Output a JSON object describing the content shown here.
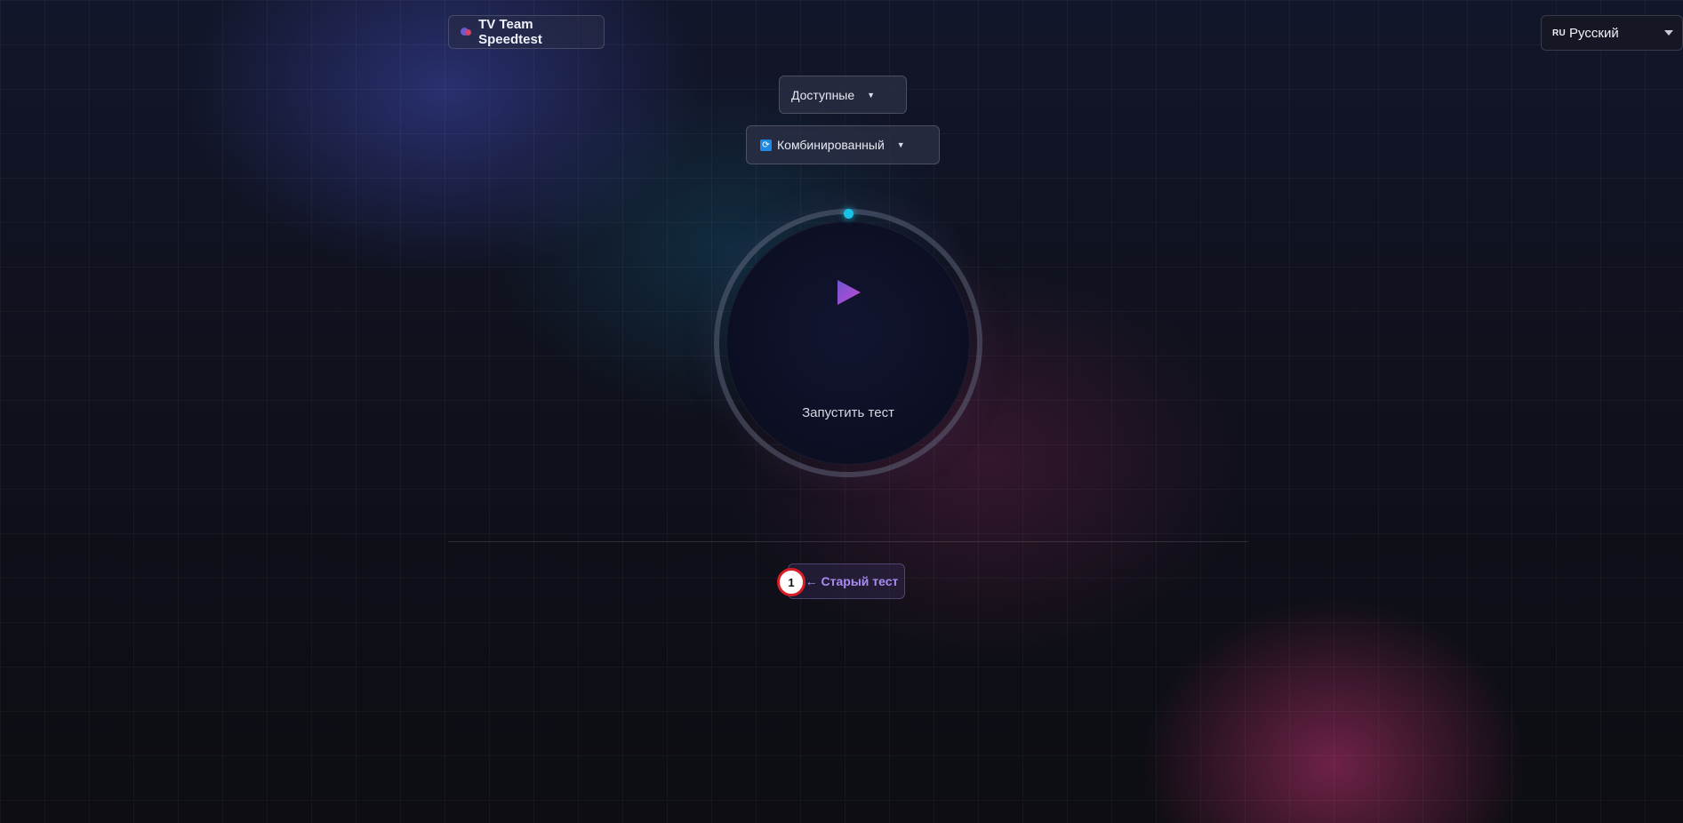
{
  "header": {
    "brand_label": "TV Team Speedtest",
    "brand_icon": "speedtest-logo-icon"
  },
  "language": {
    "code": "RU",
    "label": "Русский"
  },
  "filters": {
    "availability": {
      "label": "Доступные",
      "caret": "▼"
    },
    "mode": {
      "label": "Комбинированный",
      "caret": "▼",
      "icon": "refresh-icon"
    }
  },
  "gauge": {
    "start_label": "Запустить тест",
    "play_icon": "play-icon",
    "accent_dot_color": "#19c3e6",
    "play_gradient": [
      "#6e56cf",
      "#c04ad6"
    ]
  },
  "footer": {
    "old_test_label": "← Старый тест",
    "badge_number": "1",
    "badge_color": "#d81f26"
  }
}
